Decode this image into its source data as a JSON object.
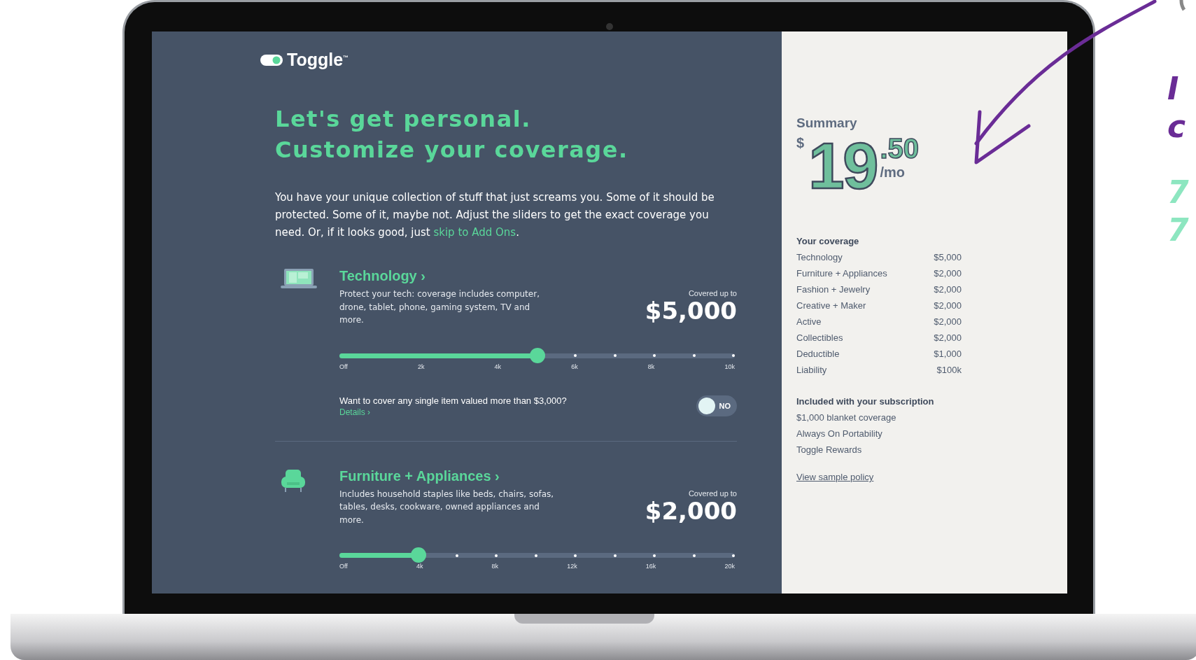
{
  "brand": {
    "name": "Toggle",
    "trademark": "™"
  },
  "headline": [
    "Let's get personal.",
    "Customize your coverage."
  ],
  "intro": "You have your unique collection of stuff that just screams you. Some of it should be protected. Some of it, maybe not. Adjust the sliders to get the exact coverage you need. Or, if it looks good, just ",
  "intro_link": "skip to Add Ons",
  "intro_end": ".",
  "categories": [
    {
      "kind": "laptop",
      "title": "Technology ›",
      "description": "Protect your tech: coverage includes computer, drone, tablet, phone, gaming system, TV and more.",
      "covered_label": "Covered up to",
      "amount": "$5,000",
      "level": 0.5,
      "ticks": [
        "Off",
        "2k",
        "4k",
        "6k",
        "8k",
        "10k"
      ],
      "question": {
        "text": "Want to cover any single item valued more than $3,000?",
        "link": "Details ›",
        "toggle_label": "NO",
        "on": false
      }
    },
    {
      "kind": "armchair",
      "title": "Furniture + Appliances ›",
      "description": "Includes household staples like beds, chairs, sofas, tables, desks, cookware, owned appliances and more.",
      "covered_label": "Covered up to",
      "amount": "$2,000",
      "level": 0.2,
      "ticks": [
        "Off",
        "4k",
        "8k",
        "12k",
        "16k",
        "20k"
      ]
    }
  ],
  "summary": {
    "title": "Summary",
    "currency": "$",
    "whole": "19",
    "cents": ".50",
    "period": "/mo",
    "coverage_title": "Your coverage",
    "coverage": [
      {
        "name": "Technology",
        "value": "$5,000"
      },
      {
        "name": "Furniture + Appliances",
        "value": "$2,000"
      },
      {
        "name": "Fashion + Jewelry",
        "value": "$2,000"
      },
      {
        "name": "Creative + Maker",
        "value": "$2,000"
      },
      {
        "name": "Active",
        "value": "$2,000"
      },
      {
        "name": "Collectibles",
        "value": "$2,000"
      },
      {
        "name": "Deductible",
        "value": "$1,000"
      },
      {
        "name": "Liability",
        "value": "$100k"
      }
    ],
    "included_title": "Included with your subscription",
    "included": [
      "$1,000 blanket coverage",
      "Always On Portability",
      "Toggle Rewards"
    ],
    "policy_link": "View sample policy"
  },
  "annotations": [
    {
      "text": "I",
      "color": "#6a2c96"
    },
    {
      "text": "c",
      "color": "#6a2c96"
    },
    {
      "text": "7",
      "color": "#8de6c0"
    },
    {
      "text": "7",
      "color": "#8de6c0"
    }
  ]
}
